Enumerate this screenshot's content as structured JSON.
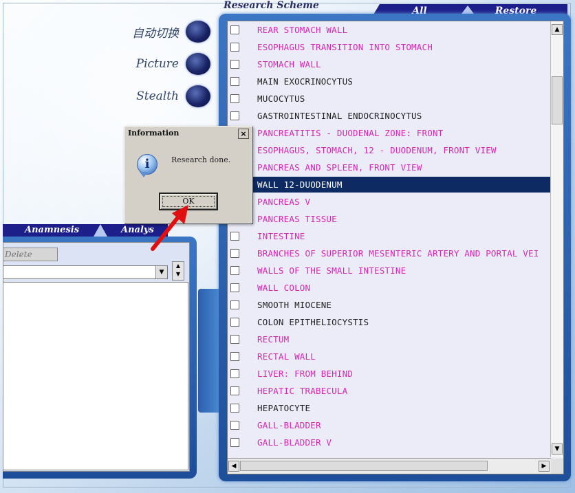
{
  "mode_switches": [
    {
      "label": "自动切换"
    },
    {
      "label": "Picture"
    },
    {
      "label": "Stealth"
    }
  ],
  "scheme": {
    "title": "Research Scheme",
    "tab_all": "All",
    "tab_restore": "Restore"
  },
  "list": {
    "items": [
      {
        "label": "REAR STOMACH WALL",
        "color": "pink"
      },
      {
        "label": "ESOPHAGUS TRANSITION INTO STOMACH",
        "color": "pink"
      },
      {
        "label": "STOMACH WALL",
        "color": "pink"
      },
      {
        "label": "MAIN EXOCRINOCYTUS",
        "color": "dark"
      },
      {
        "label": "MUCOCYTUS",
        "color": "dark"
      },
      {
        "label": "GASTROINTESTINAL ENDOCRINOCYTUS",
        "color": "dark"
      },
      {
        "label": "PANCREATITIS - DUODENAL ZONE: FRONT",
        "color": "pink"
      },
      {
        "label": "ESOPHAGUS, STOMACH, 12 - DUODENUM, FRONT VIEW",
        "color": "pink"
      },
      {
        "label": "PANCREAS  AND SPLEEN, FRONT VIEW",
        "color": "pink"
      },
      {
        "label": "WALL 12-DUODENUM",
        "color": "selected"
      },
      {
        "label": "PANCREAS  V",
        "color": "pink"
      },
      {
        "label": "PANCREAS TISSUE",
        "color": "pink"
      },
      {
        "label": "INTESTINE",
        "color": "pink"
      },
      {
        "label": "BRANCHES OF SUPERIOR MESENTERIC ARTERY AND PORTAL VEI",
        "color": "pink"
      },
      {
        "label": "WALLS OF THE SMALL INTESTINE",
        "color": "pink"
      },
      {
        "label": "WALL COLON",
        "color": "pink"
      },
      {
        "label": "SMOOTH MIOCENE",
        "color": "dark"
      },
      {
        "label": "COLON EPITHELIOCYSTIS",
        "color": "dark"
      },
      {
        "label": "RECTUM",
        "color": "pink"
      },
      {
        "label": "RECTAL WALL",
        "color": "pink"
      },
      {
        "label": "LIVER: FROM BEHIND",
        "color": "pink"
      },
      {
        "label": "HEPATIC TRABECULA",
        "color": "pink"
      },
      {
        "label": "HEPATOCYTE",
        "color": "dark"
      },
      {
        "label": "GALL-BLADDER",
        "color": "pink"
      },
      {
        "label": "GALL-BLADDER V",
        "color": "pink"
      }
    ]
  },
  "left_panel": {
    "tab_anamnesis": "Anamnesis",
    "tab_analysis": "Analys",
    "delete_label": "Delete"
  },
  "dialog": {
    "title": "Information",
    "close_glyph": "×",
    "icon_glyph": "i",
    "message": "Research done.",
    "ok_label": "OK"
  },
  "colors": {
    "tab_blue": "#1c1e8a",
    "item_pink": "#d12ab0",
    "selection": "#0d2a63",
    "arrow_red": "#e01010"
  }
}
